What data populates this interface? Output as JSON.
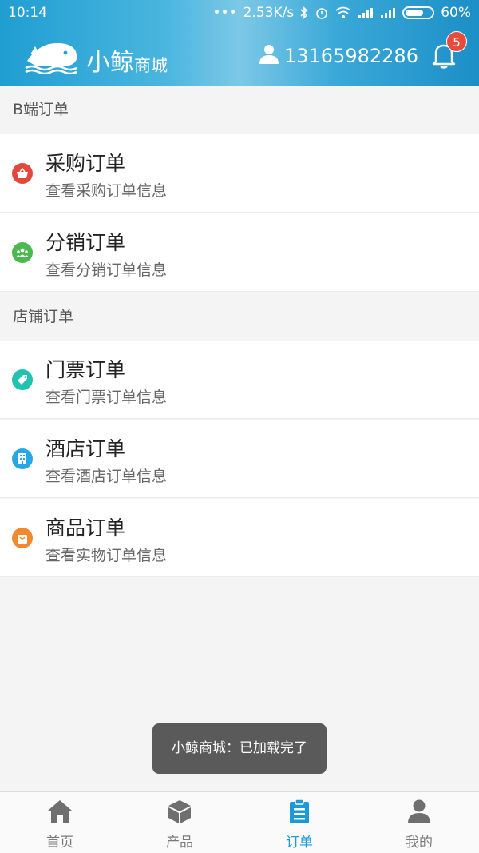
{
  "status": {
    "time": "10:14",
    "network_speed": "2.53K/s",
    "battery": "60%"
  },
  "header": {
    "logo_text_big": "小鲸",
    "logo_text_small": "商城",
    "user_phone": "13165982286",
    "notification_count": "5"
  },
  "sections": [
    {
      "title": "B端订单",
      "items": [
        {
          "title": "采购订单",
          "subtitle": "查看采购订单信息",
          "icon": "basket-icon",
          "color": "#e2483c"
        },
        {
          "title": "分销订单",
          "subtitle": "查看分销订单信息",
          "icon": "group-icon",
          "color": "#4cb84f"
        }
      ]
    },
    {
      "title": "店铺订单",
      "items": [
        {
          "title": "门票订单",
          "subtitle": "查看门票订单信息",
          "icon": "ticket-tag-icon",
          "color": "#1fc3b0"
        },
        {
          "title": "酒店订单",
          "subtitle": "查看酒店订单信息",
          "icon": "hotel-icon",
          "color": "#27a7e6"
        },
        {
          "title": "商品订单",
          "subtitle": "查看实物订单信息",
          "icon": "shopping-bag-icon",
          "color": "#f08a2c"
        }
      ]
    }
  ],
  "toast": "小鲸商城：已加载完了",
  "tabbar": [
    {
      "label": "首页",
      "icon": "home-icon",
      "active": false
    },
    {
      "label": "产品",
      "icon": "box-icon",
      "active": false
    },
    {
      "label": "订单",
      "icon": "clipboard-icon",
      "active": true
    },
    {
      "label": "我的",
      "icon": "person-icon",
      "active": false
    }
  ],
  "colors": {
    "accent": "#1a9bd7",
    "badge": "#e64b3c"
  }
}
